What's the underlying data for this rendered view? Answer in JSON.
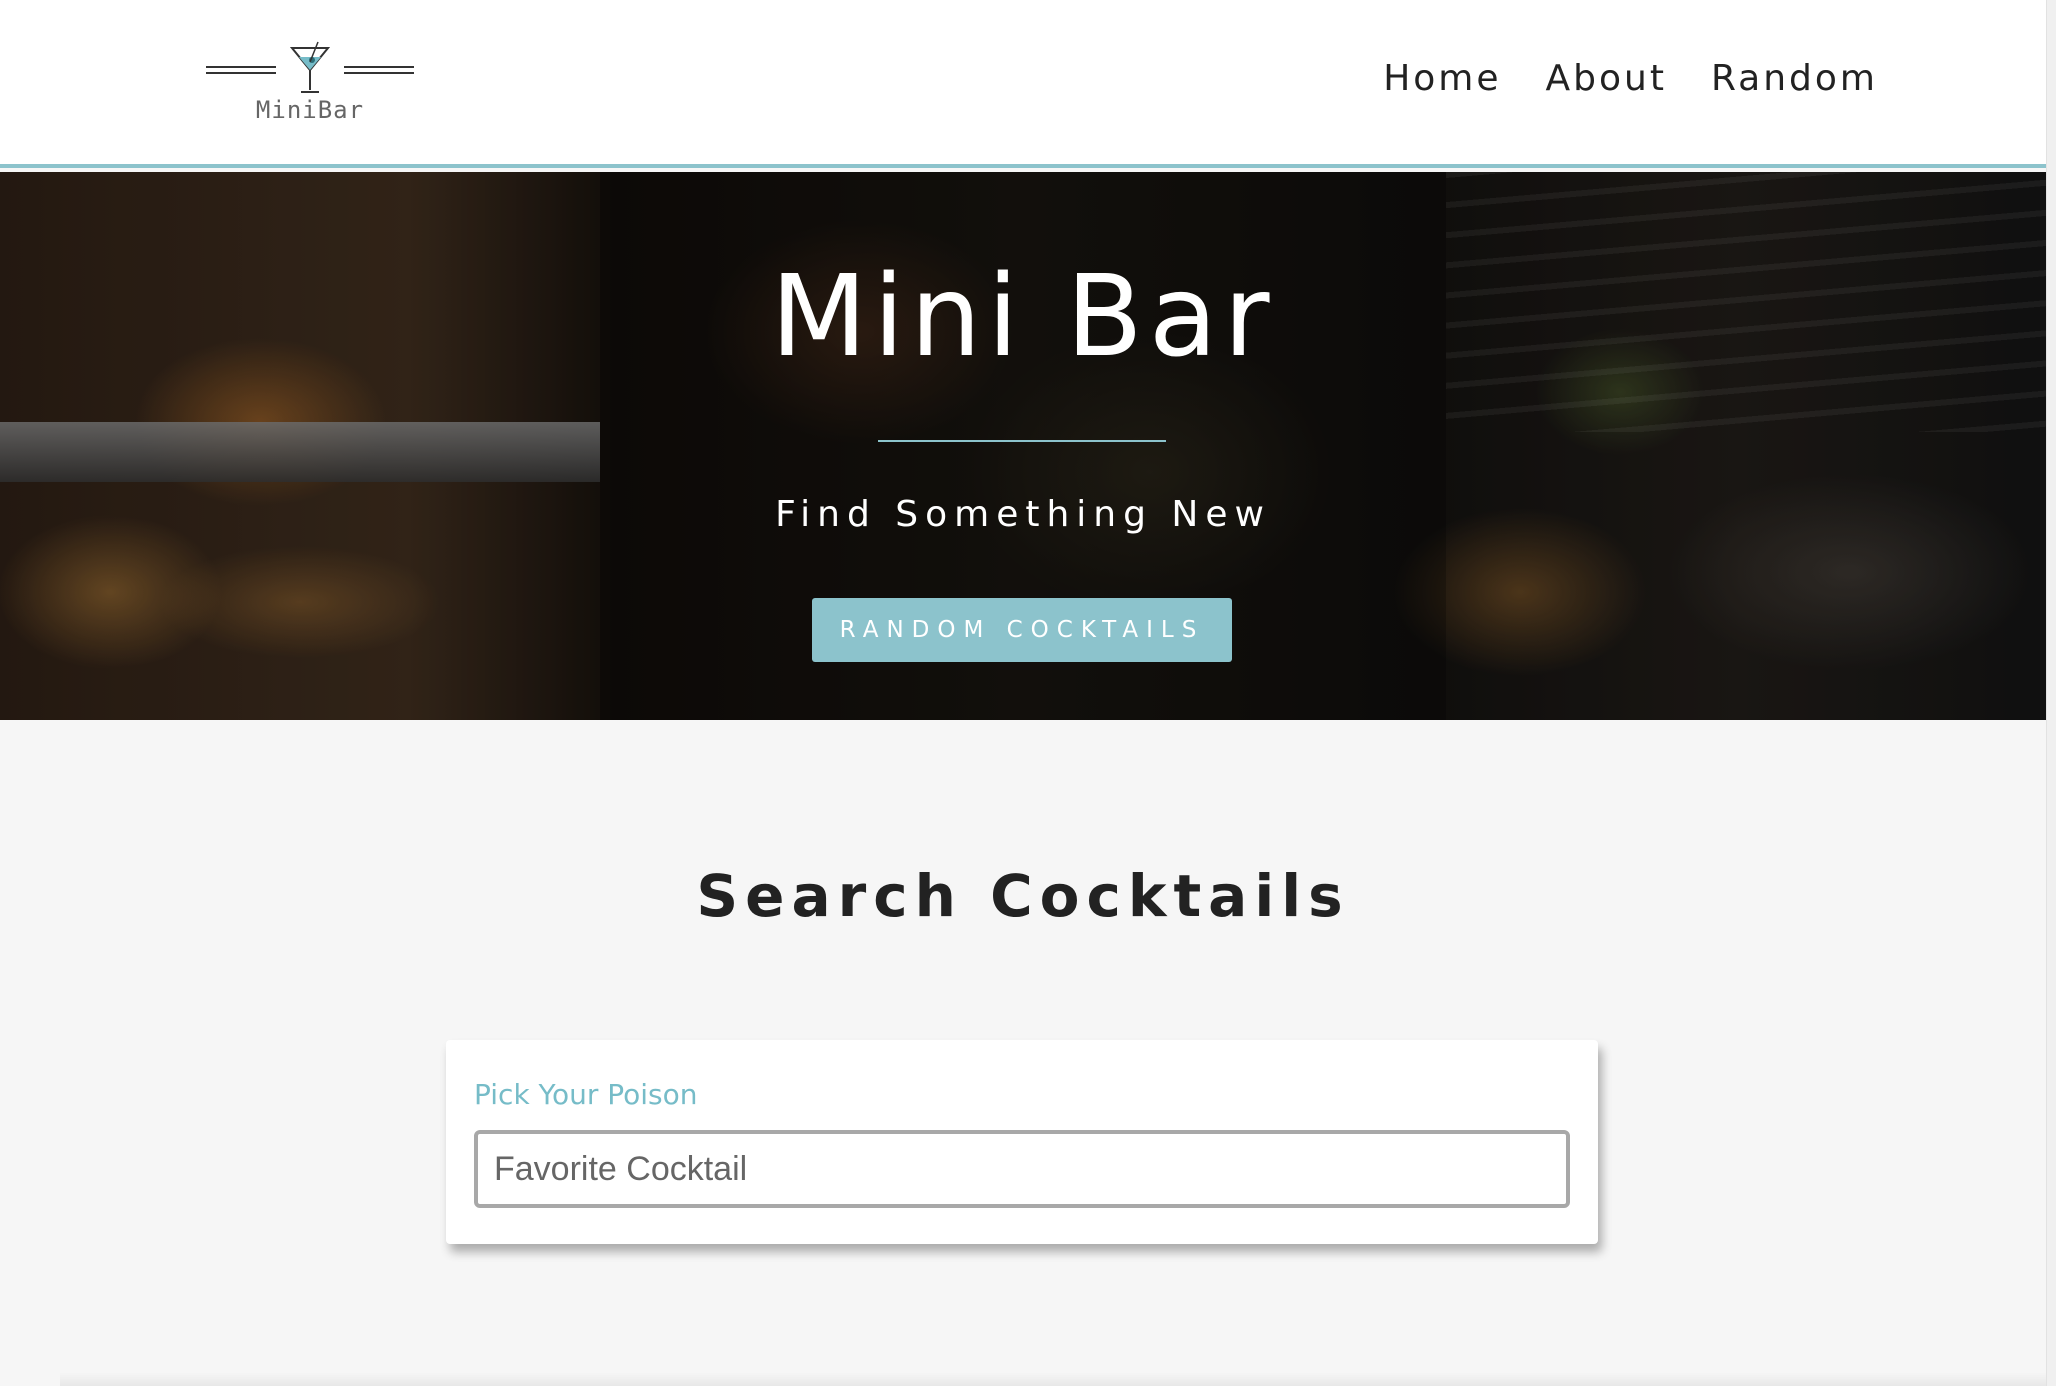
{
  "header": {
    "logo_text": "MiniBar",
    "nav": [
      {
        "label": "Home"
      },
      {
        "label": "About"
      },
      {
        "label": "Random"
      }
    ]
  },
  "hero": {
    "title": "Mini Bar",
    "subtitle": "Find Something New",
    "button_label": "RANDOM COCKTAILS"
  },
  "search": {
    "title": "Search Cocktails",
    "label": "Pick Your Poison",
    "placeholder": "Favorite Cocktail"
  },
  "colors": {
    "accent": "#8cc3cc",
    "label": "#76bcc8",
    "page_background": "#f6f6f6",
    "text": "#222222"
  },
  "icons": {
    "logo": "martini-glass-icon"
  }
}
